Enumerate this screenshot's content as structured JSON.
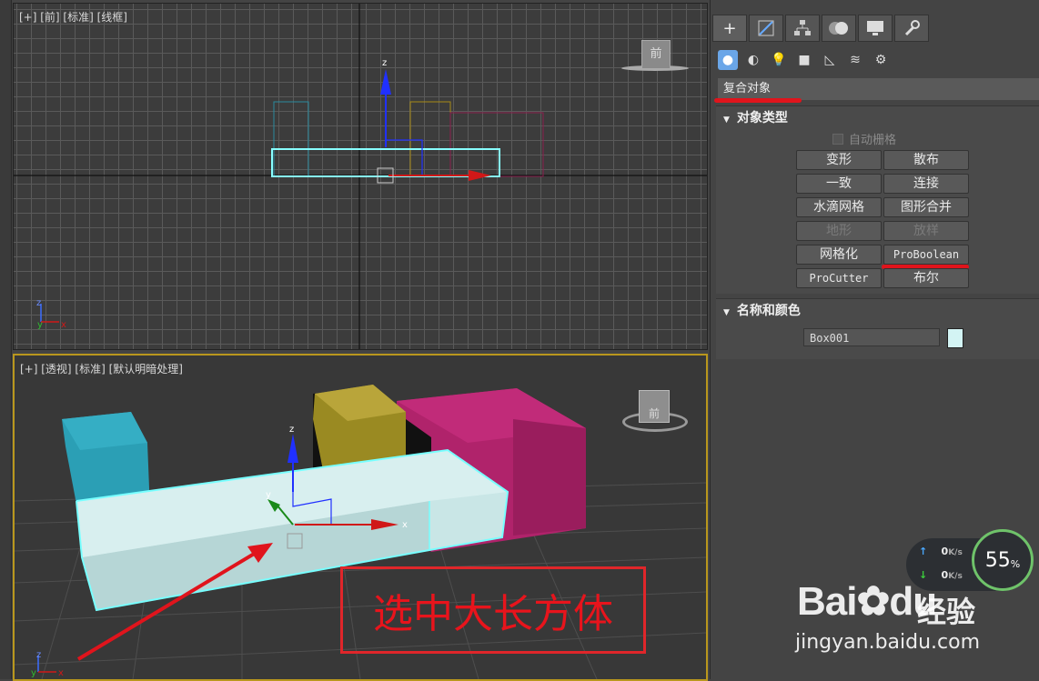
{
  "front_viewport": {
    "label": "[+] [前] [标准] [线框]",
    "axis_labels": {
      "z": "z",
      "y": "y",
      "x": "x"
    },
    "viewcube_label": "前"
  },
  "persp_viewport": {
    "label": "[+] [透视] [标准] [默认明暗处理]",
    "axis_labels": {
      "z": "z",
      "y": "y",
      "x": "x"
    },
    "viewcube_label": "前",
    "annotation": "选中大长方体"
  },
  "panel": {
    "tabs": [
      "create",
      "modify",
      "hierarchy",
      "motion",
      "display",
      "utilities"
    ],
    "category_dropdown": "复合对象",
    "object_type": {
      "title": "对象类型",
      "autogrid": "自动栅格",
      "buttons": [
        {
          "label": "变形",
          "enabled": true
        },
        {
          "label": "散布",
          "enabled": true
        },
        {
          "label": "一致",
          "enabled": true
        },
        {
          "label": "连接",
          "enabled": true
        },
        {
          "label": "水滴网格",
          "enabled": true
        },
        {
          "label": "图形合并",
          "enabled": true
        },
        {
          "label": "地形",
          "enabled": false
        },
        {
          "label": "放样",
          "enabled": false
        },
        {
          "label": "网格化",
          "enabled": true
        },
        {
          "label": "ProBoolean",
          "enabled": true
        },
        {
          "label": "ProCutter",
          "enabled": true
        },
        {
          "label": "布尔",
          "enabled": true
        }
      ]
    },
    "name_color": {
      "title": "名称和颜色",
      "name": "Box001",
      "color": "#d3f4f4"
    }
  },
  "network": {
    "upload": "0",
    "download": "0",
    "unit": "K/s",
    "percent": "55",
    "percent_sign": "%"
  },
  "watermark": {
    "logo": "Bai",
    "logo_end": "du",
    "chinese": "经验",
    "url": "jingyan.baidu.com"
  },
  "colors": {
    "accent_red": "#e0141c",
    "selection_cyan": "#7ff",
    "active_border": "#b9971d"
  }
}
